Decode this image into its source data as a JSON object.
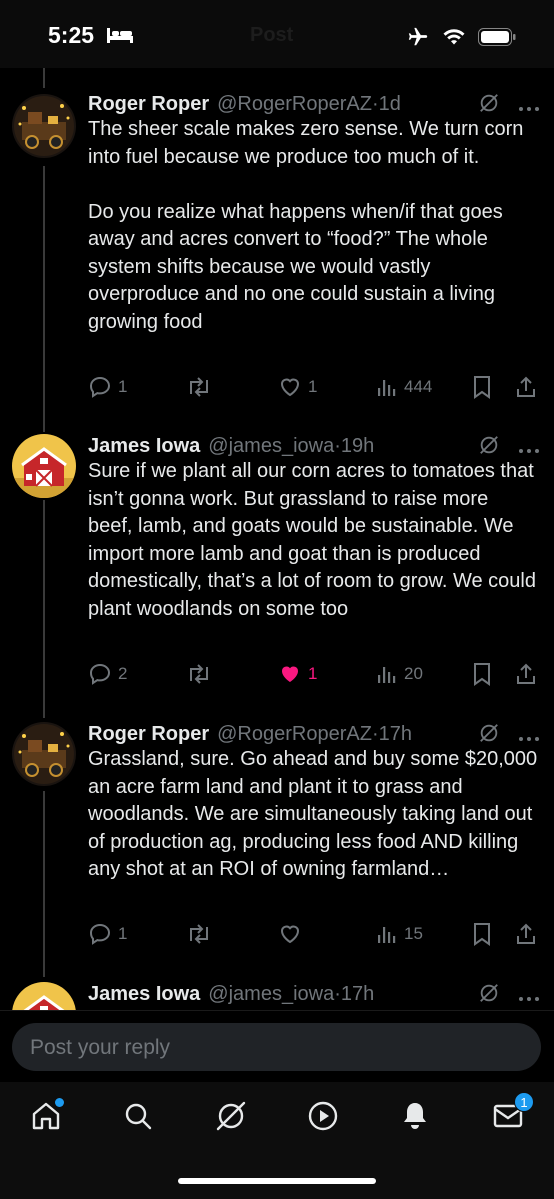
{
  "status_bar": {
    "time": "5:25",
    "ghost_title": "Post"
  },
  "posts": [
    {
      "name": "Roger Roper",
      "handle": "@RogerRoperAZ",
      "time": "·1d",
      "text": "The sheer scale makes zero sense. We turn corn into fuel because we produce too much of it.\n\nDo you realize what happens when/if that goes away and acres convert to “food?” The whole system shifts because we would vastly overproduce and no one could sustain a living growing food",
      "replies": "1",
      "reposts": "",
      "likes": "1",
      "views": "444",
      "liked": false
    },
    {
      "name": "James Iowa",
      "handle": "@james_iowa",
      "time": "·19h",
      "text": "Sure if we plant all our corn acres to tomatoes that isn’t gonna work. But grassland to raise more beef, lamb, and goats would be sustainable. We import more lamb and goat than is produced domestically, that’s a lot of room to grow. We could plant woodlands on some too",
      "replies": "2",
      "reposts": "",
      "likes": "1",
      "views": "20",
      "liked": true
    },
    {
      "name": "Roger Roper",
      "handle": "@RogerRoperAZ",
      "time": "·17h",
      "text": "Grassland, sure. Go ahead and buy some $20,000 an acre farm land and plant it to grass and woodlands. We are simultaneously taking land out of production ag, producing less food AND killing any shot at an ROI of owning farmland…",
      "replies": "1",
      "reposts": "",
      "likes": "",
      "views": "15",
      "liked": false
    },
    {
      "name": "James Iowa",
      "handle": "@james_iowa",
      "time": "·17h"
    }
  ],
  "reply": {
    "placeholder": "Post your reply"
  },
  "tabs": [
    {
      "icon": "home-icon"
    },
    {
      "icon": "search-icon"
    },
    {
      "icon": "grok-icon"
    },
    {
      "icon": "video-icon"
    },
    {
      "icon": "bell-icon"
    },
    {
      "icon": "mail-icon",
      "badge": "1"
    }
  ],
  "colors": {
    "like": "#f91880",
    "accent": "#1d9bf0",
    "muted": "#71767b"
  }
}
